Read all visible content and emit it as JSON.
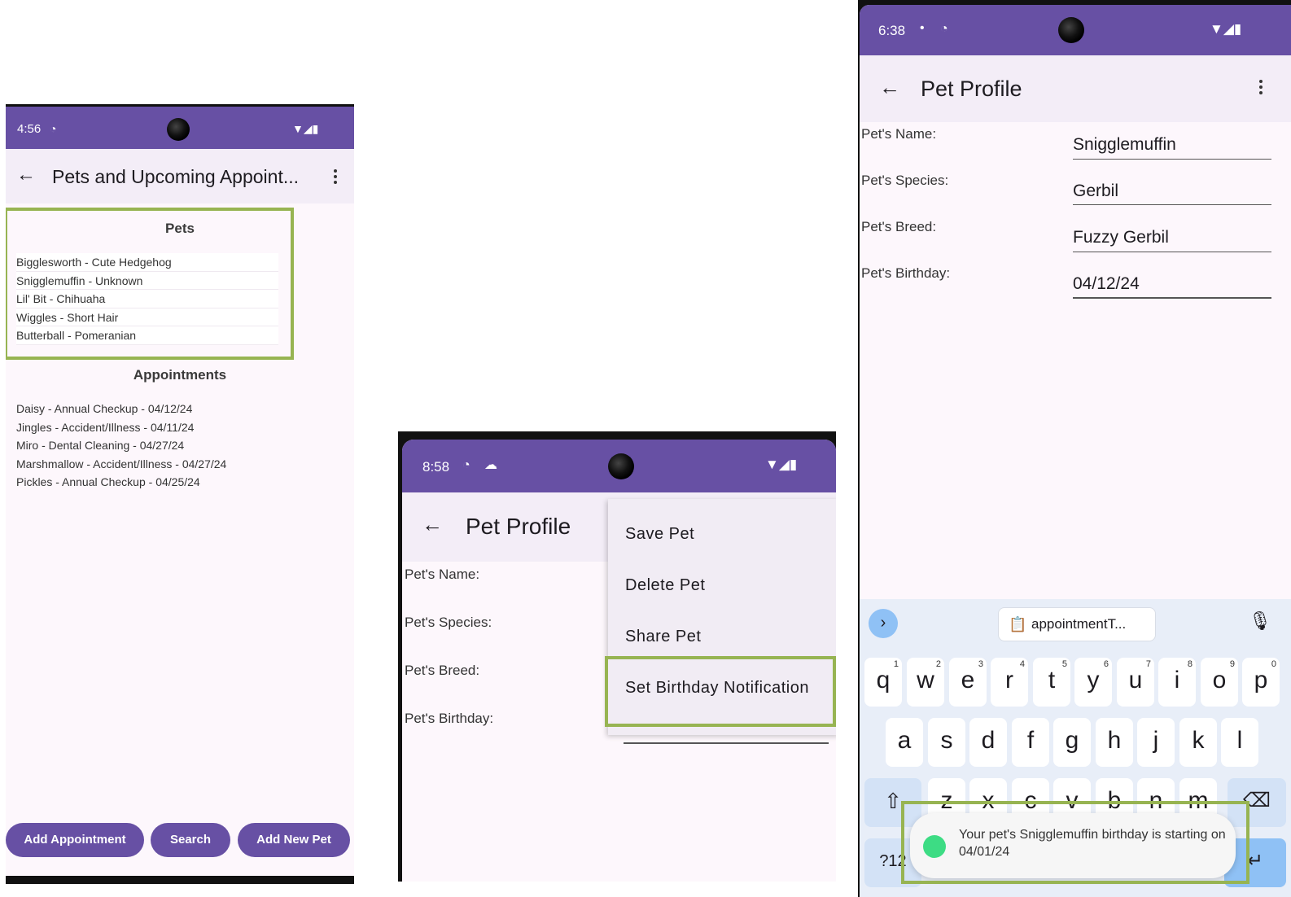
{
  "phone1": {
    "status_time": "4:56",
    "title": "Pets and Upcoming Appoint...",
    "pets_heading": "Pets",
    "pets": [
      "Bigglesworth - Cute Hedgehog",
      "Snigglemuffin - Unknown",
      "Lil' Bit - Chihuaha",
      "Wiggles - Short Hair",
      "Butterball - Pomeranian"
    ],
    "appointments_heading": "Appointments",
    "appointments": [
      "Daisy - Annual Checkup - 04/12/24",
      "Jingles - Accident/Illness - 04/11/24",
      "Miro - Dental Cleaning - 04/27/24",
      "Marshmallow - Accident/Illness - 04/27/24",
      "Pickles - Annual Checkup - 04/25/24"
    ],
    "buttons": {
      "add_appointment": "Add Appointment",
      "search": "Search",
      "add_new_pet": "Add New Pet"
    }
  },
  "phone2": {
    "status_time": "8:58",
    "title": "Pet Profile",
    "labels": {
      "name": "Pet's Name:",
      "species": "Pet's Species:",
      "breed": "Pet's Breed:",
      "birthday": "Pet's Birthday:"
    },
    "menu": [
      "Save Pet",
      "Delete Pet",
      "Share Pet",
      "Set Birthday Notification"
    ]
  },
  "phone3": {
    "status_time": "6:38",
    "title": "Pet Profile",
    "labels": {
      "name": "Pet's Name:",
      "species": "Pet's Species:",
      "breed": "Pet's Breed:",
      "birthday": "Pet's Birthday:"
    },
    "values": {
      "name": "Snigglemuffin",
      "species": "Gerbil",
      "breed": "Fuzzy Gerbil",
      "birthday": "04/12/24"
    },
    "clipboard_suggestion": "appointmentT...",
    "keyboard": {
      "row1": [
        [
          "q",
          "1"
        ],
        [
          "w",
          "2"
        ],
        [
          "e",
          "3"
        ],
        [
          "r",
          "4"
        ],
        [
          "t",
          "5"
        ],
        [
          "y",
          "6"
        ],
        [
          "u",
          "7"
        ],
        [
          "i",
          "8"
        ],
        [
          "o",
          "9"
        ],
        [
          "p",
          "0"
        ]
      ],
      "row2": [
        "a",
        "s",
        "d",
        "f",
        "g",
        "h",
        "j",
        "k",
        "l"
      ],
      "row3": [
        "z",
        "x",
        "c",
        "v",
        "b",
        "n",
        "m"
      ],
      "symbols_key": "?12"
    },
    "toast": "Your pet's Snigglemuffin birthday is starting on 04/01/24"
  },
  "colors": {
    "primary": "#6750a4",
    "highlight": "#97b452",
    "surface": "#fdf7fc"
  }
}
